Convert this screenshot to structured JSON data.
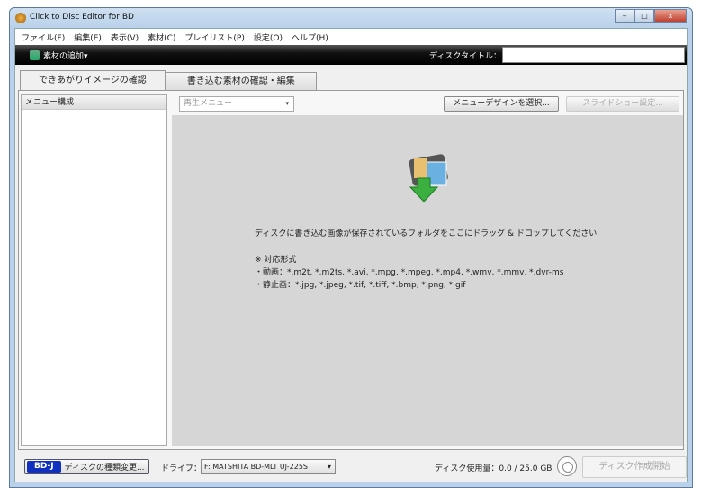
{
  "window": {
    "title": "Click to Disc Editor for BD",
    "minimize": "‒",
    "maximize": "□",
    "close": "x"
  },
  "menu": [
    "ファイル(F)",
    "編集(E)",
    "表示(V)",
    "素材(C)",
    "プレイリスト(P)",
    "設定(O)",
    "ヘルプ(H)"
  ],
  "toolbar": {
    "add_material": "素材の追加▾",
    "disc_title_label": "ディスクタイトル：",
    "disc_title_value": ""
  },
  "tabs": [
    {
      "label": "できあがりイメージの確認",
      "active": true
    },
    {
      "label": "書き込む素材の確認・編集",
      "active": false
    }
  ],
  "left_pane": {
    "header": "メニュー構成"
  },
  "right_toolbar": {
    "menu_select": "再生メニュー",
    "menu_select_arrow": "▾",
    "design_button": "メニューデザインを選択...",
    "slideshow_button": "スライドショー設定..."
  },
  "drop_area": {
    "message": "ディスクに書き込む画像が保存されているフォルダをここにドラッグ & ドロップしてください",
    "formats_title": "※ 対応形式",
    "video": "・動画：*.m2t, *.m2ts, *.avi, *.mpg, *.mpeg, *.mp4, *.wmv, *.mmv, *.dvr-ms",
    "still": "・静止画：*.jpg, *.jpeg, *.tif, *.tiff, *.bmp, *.png, *.gif"
  },
  "bottom": {
    "disc_type_badge": "BD-J",
    "disc_type_button": "ディスクの種類変更...",
    "drive_label": "ドライブ：",
    "drive_value": "F: MATSHITA BD-MLT UJ-225S",
    "drive_arrow": "▾",
    "usage": "ディスク使用量：0.0 / 25.0 GB",
    "start_button": "ディスク作成開始"
  }
}
